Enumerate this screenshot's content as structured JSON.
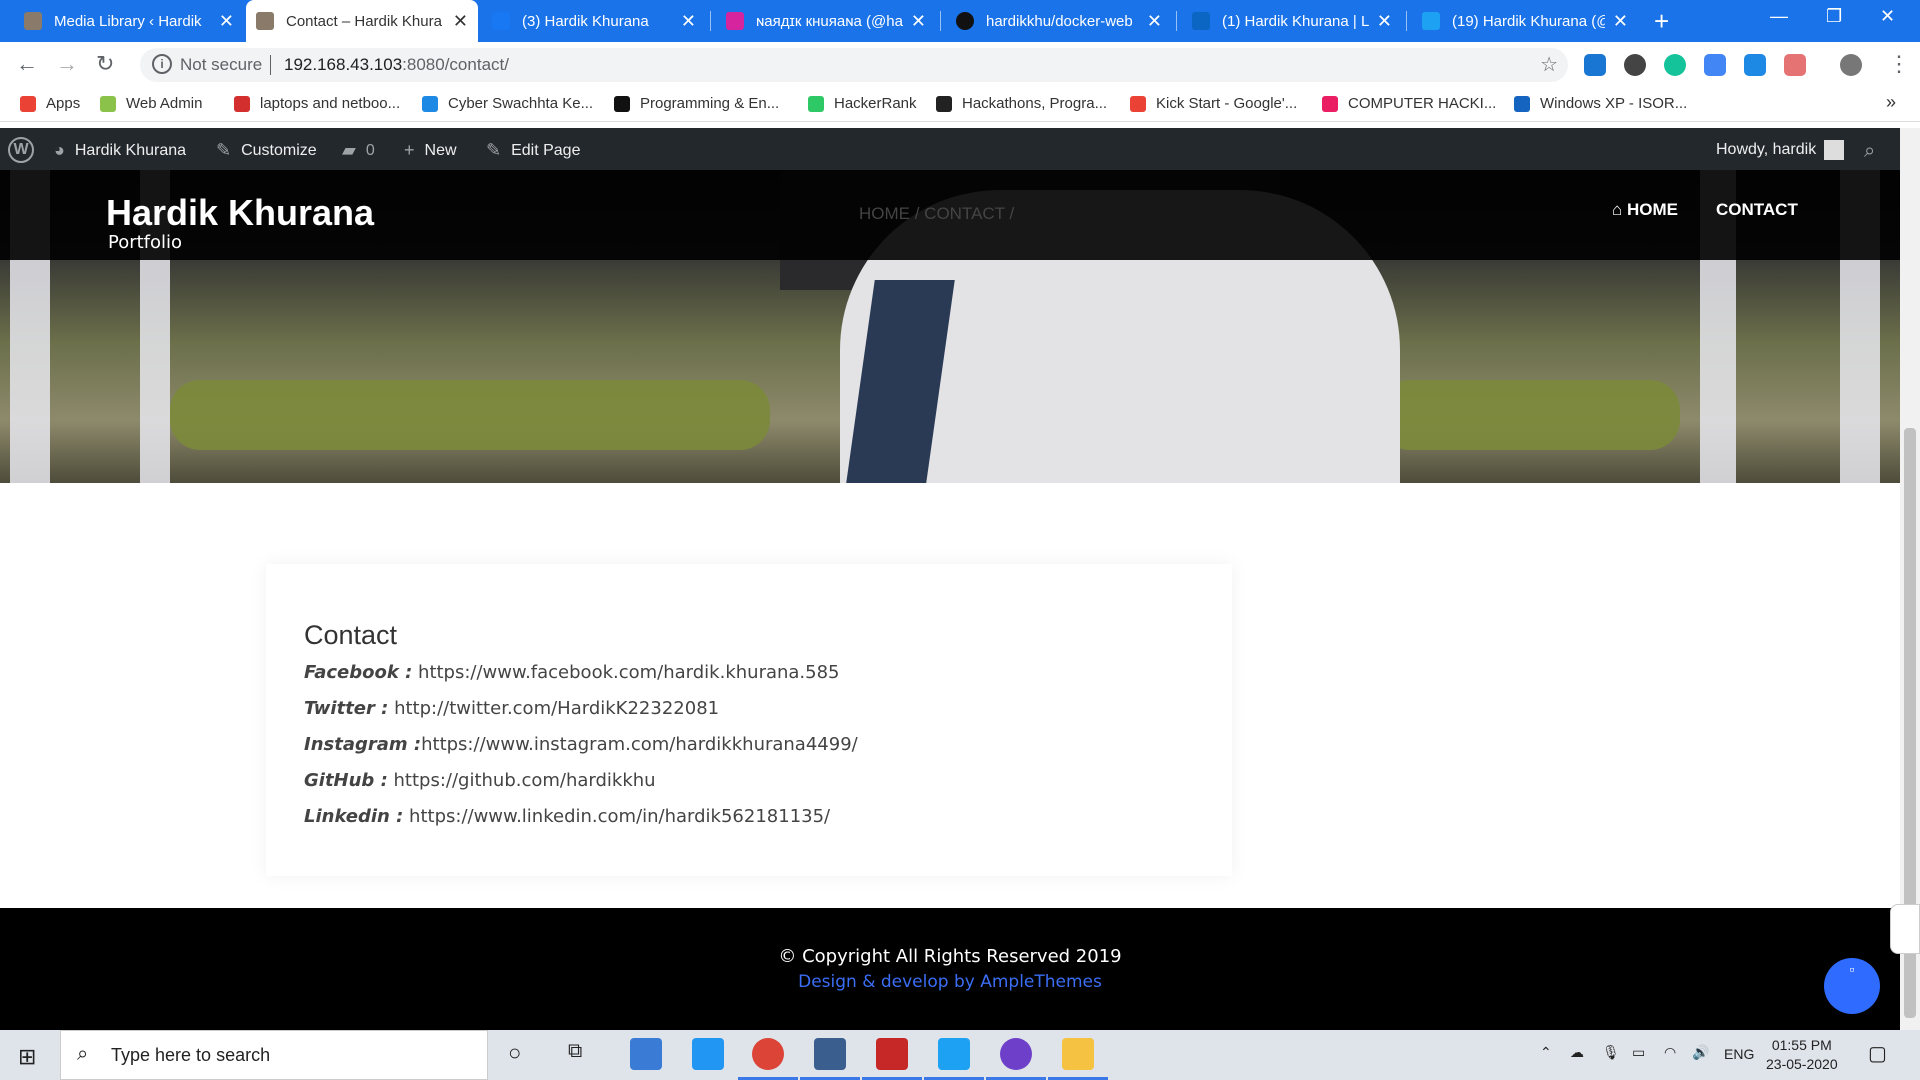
{
  "browser": {
    "tabs": [
      {
        "title": "Media Library ‹ Hardik",
        "favicon_color": "#8a7a6a"
      },
      {
        "title": "Contact – Hardik Khura",
        "favicon_color": "#8a7a6a"
      },
      {
        "title": "(3) Hardik Khurana",
        "favicon_color": "#1877f2"
      },
      {
        "title": "ɴаядɪк кнuяаɴа (@har",
        "favicon_color": "#d6249f"
      },
      {
        "title": "hardikkhu/docker-web",
        "favicon_color": "#111111"
      },
      {
        "title": "(1) Hardik Khurana | Lin",
        "favicon_color": "#0a66c2"
      },
      {
        "title": "(19) Hardik Khurana (@",
        "favicon_color": "#1da1f2"
      }
    ],
    "new_tab": "+",
    "not_secure": "Not secure",
    "url_host": "192.168.43.103",
    "url_rest": ":8080/contact/",
    "bookmarks": [
      {
        "label": "Apps",
        "color": "#ea4335"
      },
      {
        "label": "Web Admin",
        "color": "#8bc34a"
      },
      {
        "label": "laptops and netboo...",
        "color": "#d32f2f"
      },
      {
        "label": "Cyber Swachhta Ke...",
        "color": "#1e88e5"
      },
      {
        "label": "Programming & En...",
        "color": "#111111"
      },
      {
        "label": "HackerRank",
        "color": "#2ec866"
      },
      {
        "label": "Hackathons, Progra...",
        "color": "#222222"
      },
      {
        "label": "Kick Start - Google'...",
        "color": "#ea4335"
      },
      {
        "label": "COMPUTER HACKI...",
        "color": "#e91e63"
      },
      {
        "label": "Windows XP - ISOR...",
        "color": "#1565c0"
      }
    ],
    "more": "»"
  },
  "wp_admin_bar": {
    "site_name": "Hardik Khurana",
    "customize": "Customize",
    "comments": "0",
    "new": "New",
    "edit_page": "Edit Page",
    "howdy": "Howdy, hardik"
  },
  "site": {
    "title": "Hardik Khurana",
    "tagline": "Portfolio",
    "breadcrumb": "HOME /  CONTACT /",
    "nav": [
      {
        "label": "HOME"
      },
      {
        "label": "CONTACT"
      }
    ]
  },
  "contact": {
    "heading": "Contact",
    "items": [
      {
        "label": "Facebook :",
        "value": " https://www.facebook.com/hardik.khurana.585"
      },
      {
        "label": "Twitter :",
        "value": " http://twitter.com/HardikK22322081"
      },
      {
        "label": "Instagram :",
        "value": "https://www.instagram.com/hardikkhurana4499/"
      },
      {
        "label": "GitHub :",
        "value": " https://github.com/hardikkhu"
      },
      {
        "label": "Linkedin :",
        "value": " https://www.linkedin.com/in/hardik562181135/"
      }
    ]
  },
  "footer": {
    "copyright": "© Copyright All Rights Reserved 2019",
    "credit": "Design & develop by AmpleThemes"
  },
  "taskbar": {
    "search_placeholder": "Type here to search",
    "lang": "ENG",
    "time": "01:55 PM",
    "date": "23-05-2020"
  },
  "colors": {
    "tab_strip": "#1a73e8",
    "wp_bar": "#23282d",
    "footer": "#000000",
    "link_blue": "#3b6ef5"
  }
}
